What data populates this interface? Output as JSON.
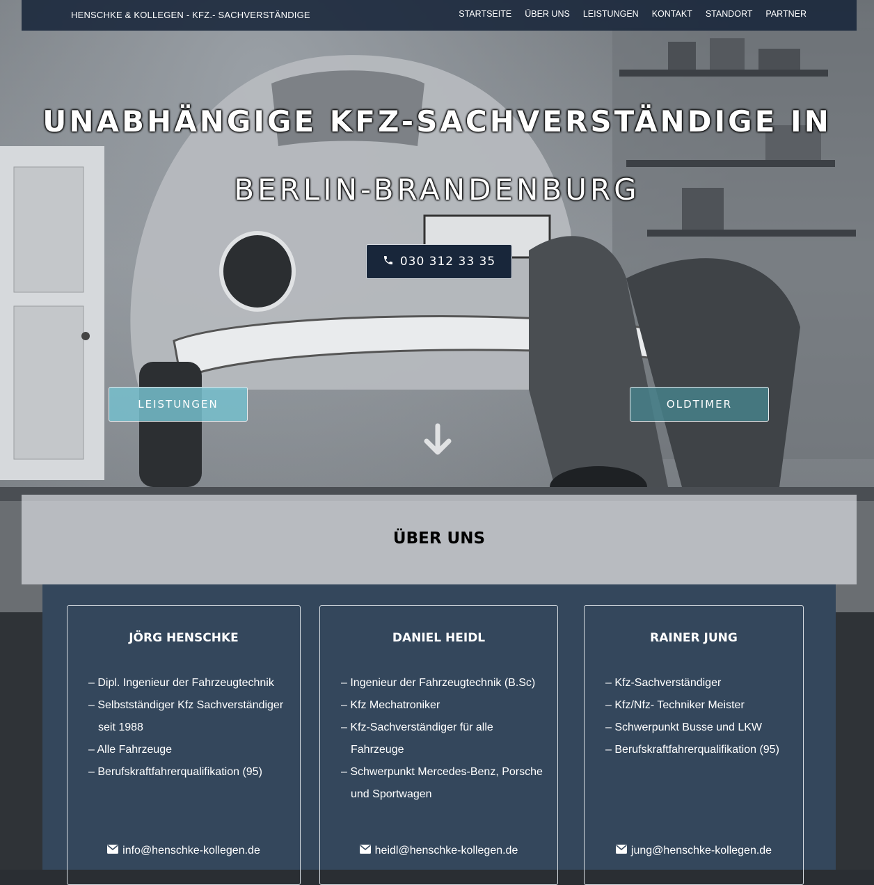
{
  "navbar": {
    "brand": "HENSCHKE & KOLLEGEN - KFZ.- SACHVERSTÄNDIGE",
    "links": [
      "STARTSEITE",
      "ÜBER UNS",
      "LEISTUNGEN",
      "KONTAKT",
      "STANDORT",
      "PARTNER"
    ]
  },
  "hero": {
    "title_line1": "UNABHÄNGIGE KFZ-SACHVERSTÄNDIGE IN",
    "title_line2": "BERLIN-BRANDENBURG",
    "phone": "030 312 33 35",
    "phone_icon": "phone-icon",
    "cta_left": "LEISTUNGEN",
    "cta_right": "OLDTIMER",
    "scroll_icon": "arrow-down-icon"
  },
  "about": {
    "title": "ÜBER UNS",
    "cards": [
      {
        "name": "JÖRG HENSCHKE",
        "items": [
          "– Dipl. Ingenieur der Fahrzeugtechnik",
          "– Selbstständiger Kfz Sachverständiger seit 1988",
          "– Alle Fahrzeuge",
          "– Berufskraftfahrerqualifikation (95)"
        ],
        "email": "info@henschke-kollegen.de"
      },
      {
        "name": "DANIEL HEIDL",
        "items": [
          "– Ingenieur der Fahrzeugtechnik (B.Sc)",
          "– Kfz Mechatroniker",
          "– Kfz-Sachverständiger für alle Fahrzeuge",
          "– Schwerpunkt Mercedes-Benz, Porsche und Sportwagen"
        ],
        "email": "heidl@henschke-kollegen.de"
      },
      {
        "name": "RAINER JUNG",
        "items": [
          "– Kfz-Sachverständiger",
          "– Kfz/Nfz- Techniker Meister",
          "– Schwerpunkt Busse und LKW",
          "– Berufskraftfahrerqualifikation (95)"
        ],
        "email": "jung@henschke-kollegen.de"
      }
    ],
    "mail_icon": "envelope-icon"
  },
  "colors": {
    "navbar": "#18263a",
    "panel": "#34475c",
    "cta_left": "#76becd",
    "cta_right": "#46808a"
  }
}
